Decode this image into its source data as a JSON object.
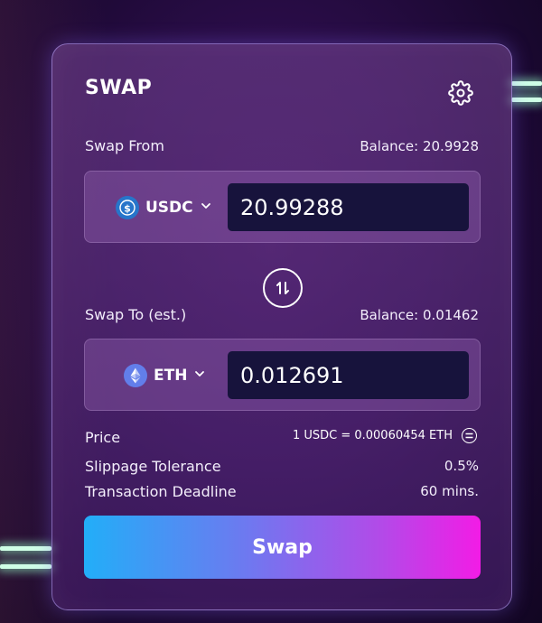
{
  "card": {
    "title": "SWAP",
    "settings_icon": "gear-icon"
  },
  "swap_from": {
    "label": "Swap From",
    "balance": "Balance: 20.9928",
    "token": "USDC",
    "token_icon": "usdc-icon",
    "amount": "20.99288"
  },
  "swap_to": {
    "label": "Swap To (est.)",
    "balance": "Balance: 0.01462",
    "token": "ETH",
    "token_icon": "eth-icon",
    "amount": "0.012691"
  },
  "switch_icon": "swap-direction-icon",
  "info": {
    "price_label": "Price",
    "price_value": "1 USDC = 0.00060454 ETH",
    "slippage_label": "Slippage Tolerance",
    "slippage_value": "0.5%",
    "deadline_label": "Transaction Deadline",
    "deadline_value": "60 mins."
  },
  "swap_button": "Swap",
  "colors": {
    "accent_start": "#22aef8",
    "accent_end": "#f21ce6",
    "input_bg": "#17133c",
    "usdc_blue": "#2775ca",
    "eth_purple": "#627eea"
  }
}
